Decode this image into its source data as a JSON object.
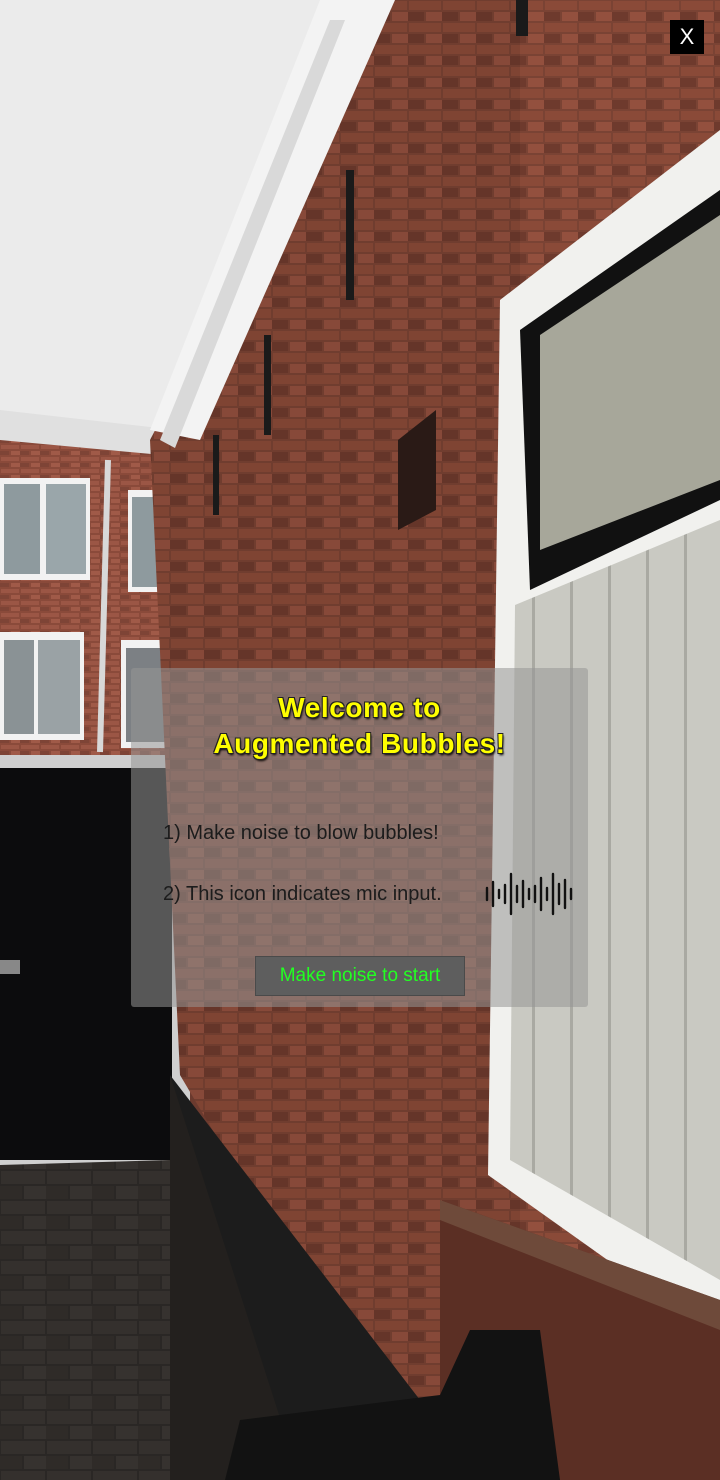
{
  "app": {
    "close_label": "X"
  },
  "welcome": {
    "title_line1": "Welcome to",
    "title_line2": "Augmented Bubbles!",
    "step1": "1) Make noise to blow bubbles!",
    "step2": "2) This icon indicates mic input.",
    "mic_icon": "sound-wave-icon",
    "start_button": "Make noise to start"
  },
  "colors": {
    "title": "#ffff00",
    "start_button_text": "#22ff22",
    "panel": "rgba(150,150,150,0.55)"
  }
}
